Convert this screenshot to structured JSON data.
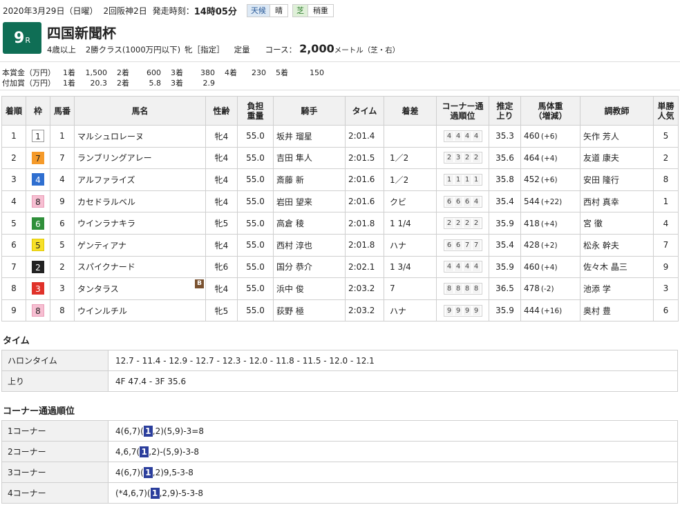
{
  "header": {
    "date": "2020年3月29日（日曜）",
    "meeting": "2回阪神2日",
    "start_label": "発走時刻：",
    "start_time": "14時05分",
    "weather_label": "天候",
    "weather_value": "晴",
    "track_label": "芝",
    "track_value": "稍重"
  },
  "race": {
    "number": "9",
    "suffix": "R",
    "name": "四国新聞杯",
    "age": "4歳以上",
    "class": "2勝クラス(1000万円以下)",
    "sex": "牝［指定］",
    "weight_rule": "定量",
    "course_label": "コース：",
    "distance": "2,000",
    "distance_unit": "メートル（芝・右）"
  },
  "prize": {
    "main_label": "本賞金（万円）",
    "main": [
      {
        "place": "1着",
        "amount": "1,500"
      },
      {
        "place": "2着",
        "amount": "600"
      },
      {
        "place": "3着",
        "amount": "380"
      },
      {
        "place": "4着",
        "amount": "230"
      },
      {
        "place": "5着",
        "amount": "150"
      }
    ],
    "extra_label": "付加賞（万円）",
    "extra": [
      {
        "place": "1着",
        "amount": "20.3"
      },
      {
        "place": "2着",
        "amount": "5.8"
      },
      {
        "place": "3着",
        "amount": "2.9"
      }
    ]
  },
  "columns": {
    "rank": "着順",
    "waku": "枠",
    "num": "馬番",
    "name": "馬名",
    "sexage": "性齢",
    "weight": "負担重量",
    "jockey": "騎手",
    "time": "タイム",
    "margin": "着差",
    "corner": "コーナー通過順位",
    "last3f": "推定上り",
    "bodyweight": "馬体重（増減）",
    "trainer": "調教師",
    "pop": "単勝人気"
  },
  "waku_colors": {
    "1": {
      "bg": "#ffffff",
      "fg": "#222222",
      "border": "#999999"
    },
    "2": {
      "bg": "#222222",
      "fg": "#ffffff",
      "border": "#222222"
    },
    "3": {
      "bg": "#e0322a",
      "fg": "#ffffff",
      "border": "#e0322a"
    },
    "4": {
      "bg": "#2f6fd0",
      "fg": "#ffffff",
      "border": "#2f6fd0"
    },
    "5": {
      "bg": "#f7e02a",
      "fg": "#222222",
      "border": "#e0c800"
    },
    "6": {
      "bg": "#2f8f3a",
      "fg": "#ffffff",
      "border": "#2f8f3a"
    },
    "7": {
      "bg": "#f59a2a",
      "fg": "#222222",
      "border": "#f59a2a"
    },
    "8": {
      "bg": "#f7bfd2",
      "fg": "#222222",
      "border": "#e99cb7"
    }
  },
  "results": [
    {
      "rank": "1",
      "waku": "1",
      "num": "1",
      "name": "マルシュロレーヌ",
      "blinker": "",
      "sexage": "牝4",
      "weight": "55.0",
      "jockey": "坂井 瑠星",
      "time": "2:01.4",
      "margin": "",
      "corner": [
        "4",
        "4",
        "4",
        "4"
      ],
      "last3f": "35.3",
      "bw": "460",
      "bw_diff": "(+6)",
      "trainer": "矢作 芳人",
      "pop": "5"
    },
    {
      "rank": "2",
      "waku": "7",
      "num": "7",
      "name": "ランブリングアレー",
      "blinker": "",
      "sexage": "牝4",
      "weight": "55.0",
      "jockey": "吉田 隼人",
      "time": "2:01.5",
      "margin": "1／2",
      "corner": [
        "2",
        "3",
        "2",
        "2"
      ],
      "last3f": "35.6",
      "bw": "464",
      "bw_diff": "(+4)",
      "trainer": "友道 康夫",
      "pop": "2"
    },
    {
      "rank": "3",
      "waku": "4",
      "num": "4",
      "name": "アルファライズ",
      "blinker": "",
      "sexage": "牝4",
      "weight": "55.0",
      "jockey": "斎藤 新",
      "time": "2:01.6",
      "margin": "1／2",
      "corner": [
        "1",
        "1",
        "1",
        "1"
      ],
      "last3f": "35.8",
      "bw": "452",
      "bw_diff": "(+6)",
      "trainer": "安田 隆行",
      "pop": "8"
    },
    {
      "rank": "4",
      "waku": "8",
      "num": "9",
      "name": "カセドラルベル",
      "blinker": "",
      "sexage": "牝4",
      "weight": "55.0",
      "jockey": "岩田 望来",
      "time": "2:01.6",
      "margin": "クビ",
      "corner": [
        "6",
        "6",
        "6",
        "4"
      ],
      "last3f": "35.4",
      "bw": "544",
      "bw_diff": "(+22)",
      "trainer": "西村 真幸",
      "pop": "1"
    },
    {
      "rank": "5",
      "waku": "6",
      "num": "6",
      "name": "ウインラナキラ",
      "blinker": "",
      "sexage": "牝5",
      "weight": "55.0",
      "jockey": "高倉 稜",
      "time": "2:01.8",
      "margin": "1 1/4",
      "corner": [
        "2",
        "2",
        "2",
        "2"
      ],
      "last3f": "35.9",
      "bw": "418",
      "bw_diff": "(+4)",
      "trainer": "宮 徹",
      "pop": "4"
    },
    {
      "rank": "6",
      "waku": "5",
      "num": "5",
      "name": "ゲンティアナ",
      "blinker": "",
      "sexage": "牝4",
      "weight": "55.0",
      "jockey": "西村 淳也",
      "time": "2:01.8",
      "margin": "ハナ",
      "corner": [
        "6",
        "6",
        "7",
        "7"
      ],
      "last3f": "35.4",
      "bw": "428",
      "bw_diff": "(+2)",
      "trainer": "松永 幹夫",
      "pop": "7"
    },
    {
      "rank": "7",
      "waku": "2",
      "num": "2",
      "name": "スパイクナード",
      "blinker": "",
      "sexage": "牝6",
      "weight": "55.0",
      "jockey": "国分 恭介",
      "time": "2:02.1",
      "margin": "1 3/4",
      "corner": [
        "4",
        "4",
        "4",
        "4"
      ],
      "last3f": "35.9",
      "bw": "460",
      "bw_diff": "(+4)",
      "trainer": "佐々木 晶三",
      "pop": "9"
    },
    {
      "rank": "8",
      "waku": "3",
      "num": "3",
      "name": "タンタラス",
      "blinker": "B",
      "sexage": "牝4",
      "weight": "55.0",
      "jockey": "浜中 俊",
      "time": "2:03.2",
      "margin": "7",
      "corner": [
        "8",
        "8",
        "8",
        "8"
      ],
      "last3f": "36.5",
      "bw": "478",
      "bw_diff": "(-2)",
      "trainer": "池添 学",
      "pop": "3"
    },
    {
      "rank": "9",
      "waku": "8",
      "num": "8",
      "name": "ウインルチル",
      "blinker": "",
      "sexage": "牝5",
      "weight": "55.0",
      "jockey": "荻野 極",
      "time": "2:03.2",
      "margin": "ハナ",
      "corner": [
        "9",
        "9",
        "9",
        "9"
      ],
      "last3f": "35.9",
      "bw": "444",
      "bw_diff": "(+16)",
      "trainer": "奥村 豊",
      "pop": "6"
    }
  ],
  "time_section": {
    "title": "タイム",
    "rows": [
      {
        "label": "ハロンタイム",
        "value": "12.7 - 11.4 - 12.9 - 12.7 - 12.3 - 12.0 - 11.8 - 11.5 - 12.0 - 12.1"
      },
      {
        "label": "上り",
        "value": "4F 47.4 - 3F 35.6"
      }
    ]
  },
  "corner_section": {
    "title": "コーナー通過順位",
    "rows": [
      {
        "label": "1コーナー",
        "before": "4(6,7)(",
        "hl": "1",
        "after": ",2)(5,9)-3=8"
      },
      {
        "label": "2コーナー",
        "before": "4,6,7(",
        "hl": "1",
        "after": ",2)-(5,9)-3-8"
      },
      {
        "label": "3コーナー",
        "before": "4(6,7)(",
        "hl": "1",
        "after": ",2)9,5-3-8"
      },
      {
        "label": "4コーナー",
        "before": "(*4,6,7)(",
        "hl": "1",
        "after": ",2,9)-5-3-8"
      }
    ]
  }
}
